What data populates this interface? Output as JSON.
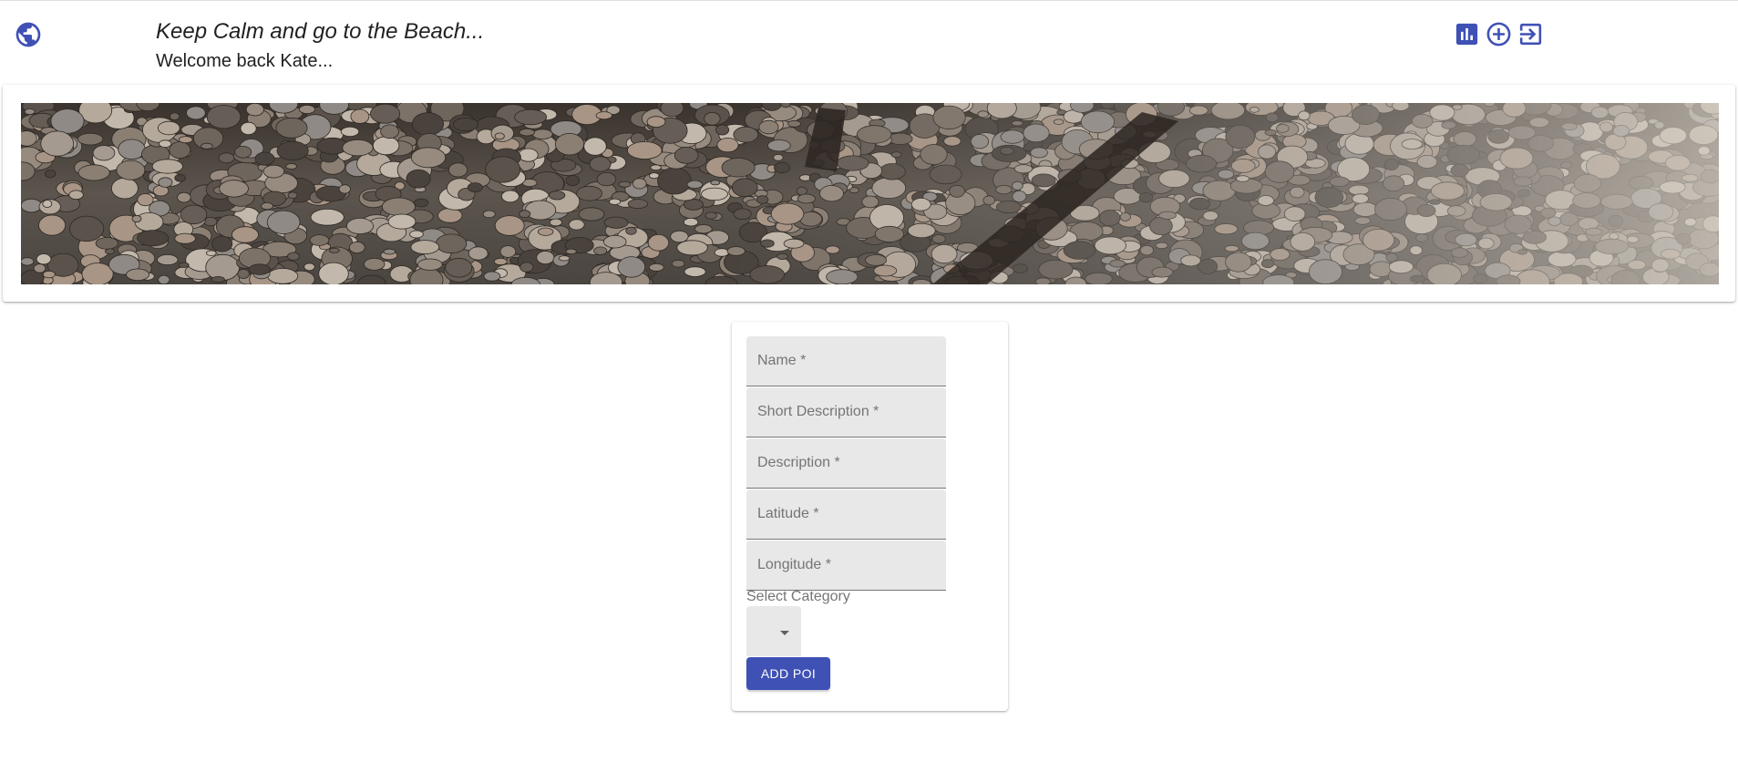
{
  "header": {
    "title": "Keep Calm and go to the Beach...",
    "subtitle": "Welcome back Kate...",
    "logo_icon": "globe-icon",
    "actions": [
      {
        "icon": "bar-chart-icon"
      },
      {
        "icon": "add-circle-icon"
      },
      {
        "icon": "logout-icon"
      }
    ]
  },
  "banner": {
    "icon": "beach-pebbles-image"
  },
  "form": {
    "fields": [
      {
        "placeholder": "Name *"
      },
      {
        "placeholder": "Short Description *"
      },
      {
        "placeholder": "Description *"
      },
      {
        "placeholder": "Latitude *"
      },
      {
        "placeholder": "Longitude *"
      }
    ],
    "category_label": "Select Category",
    "submit_label": "ADD POI"
  },
  "colors": {
    "primary": "#3f51b5",
    "field_bg": "#e8e8e8",
    "text": "#212121",
    "placeholder": "#757575"
  }
}
